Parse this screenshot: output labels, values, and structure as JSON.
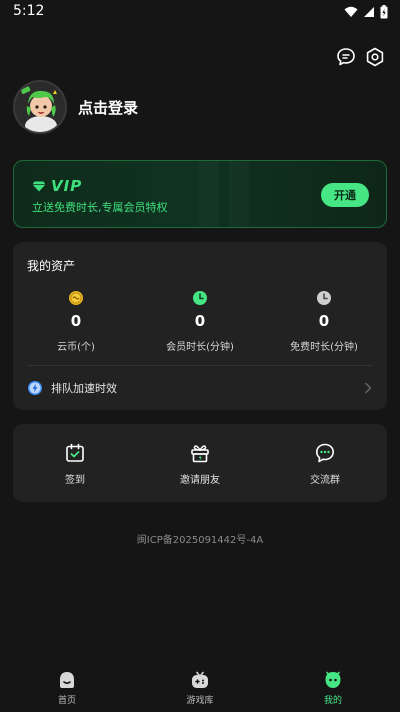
{
  "status_bar": {
    "time": "5:12"
  },
  "profile": {
    "login_label": "点击登录"
  },
  "vip": {
    "label": "VIP",
    "description": "立送免费时长,专属会员特权",
    "button_label": "开通"
  },
  "assets": {
    "title": "我的资产",
    "items": [
      {
        "value": "0",
        "label": "云币(个)",
        "icon": "coin-icon"
      },
      {
        "value": "0",
        "label": "会员时长(分钟)",
        "icon": "member-clock-icon"
      },
      {
        "value": "0",
        "label": "免费时长(分钟)",
        "icon": "free-clock-icon"
      }
    ],
    "queue_label": "排队加速时效"
  },
  "actions": [
    {
      "label": "签到",
      "icon": "calendar-check-icon"
    },
    {
      "label": "邀请朋友",
      "icon": "gift-icon"
    },
    {
      "label": "交流群",
      "icon": "chat-bubble-icon"
    }
  ],
  "icp": "闽ICP备2025091442号-4A",
  "nav": [
    {
      "label": "首页",
      "icon": "home-icon"
    },
    {
      "label": "游戏库",
      "icon": "gamepad-icon"
    },
    {
      "label": "我的",
      "icon": "profile-icon"
    }
  ],
  "colors": {
    "accent": "#46e685",
    "background": "#151515",
    "card": "#222222"
  }
}
